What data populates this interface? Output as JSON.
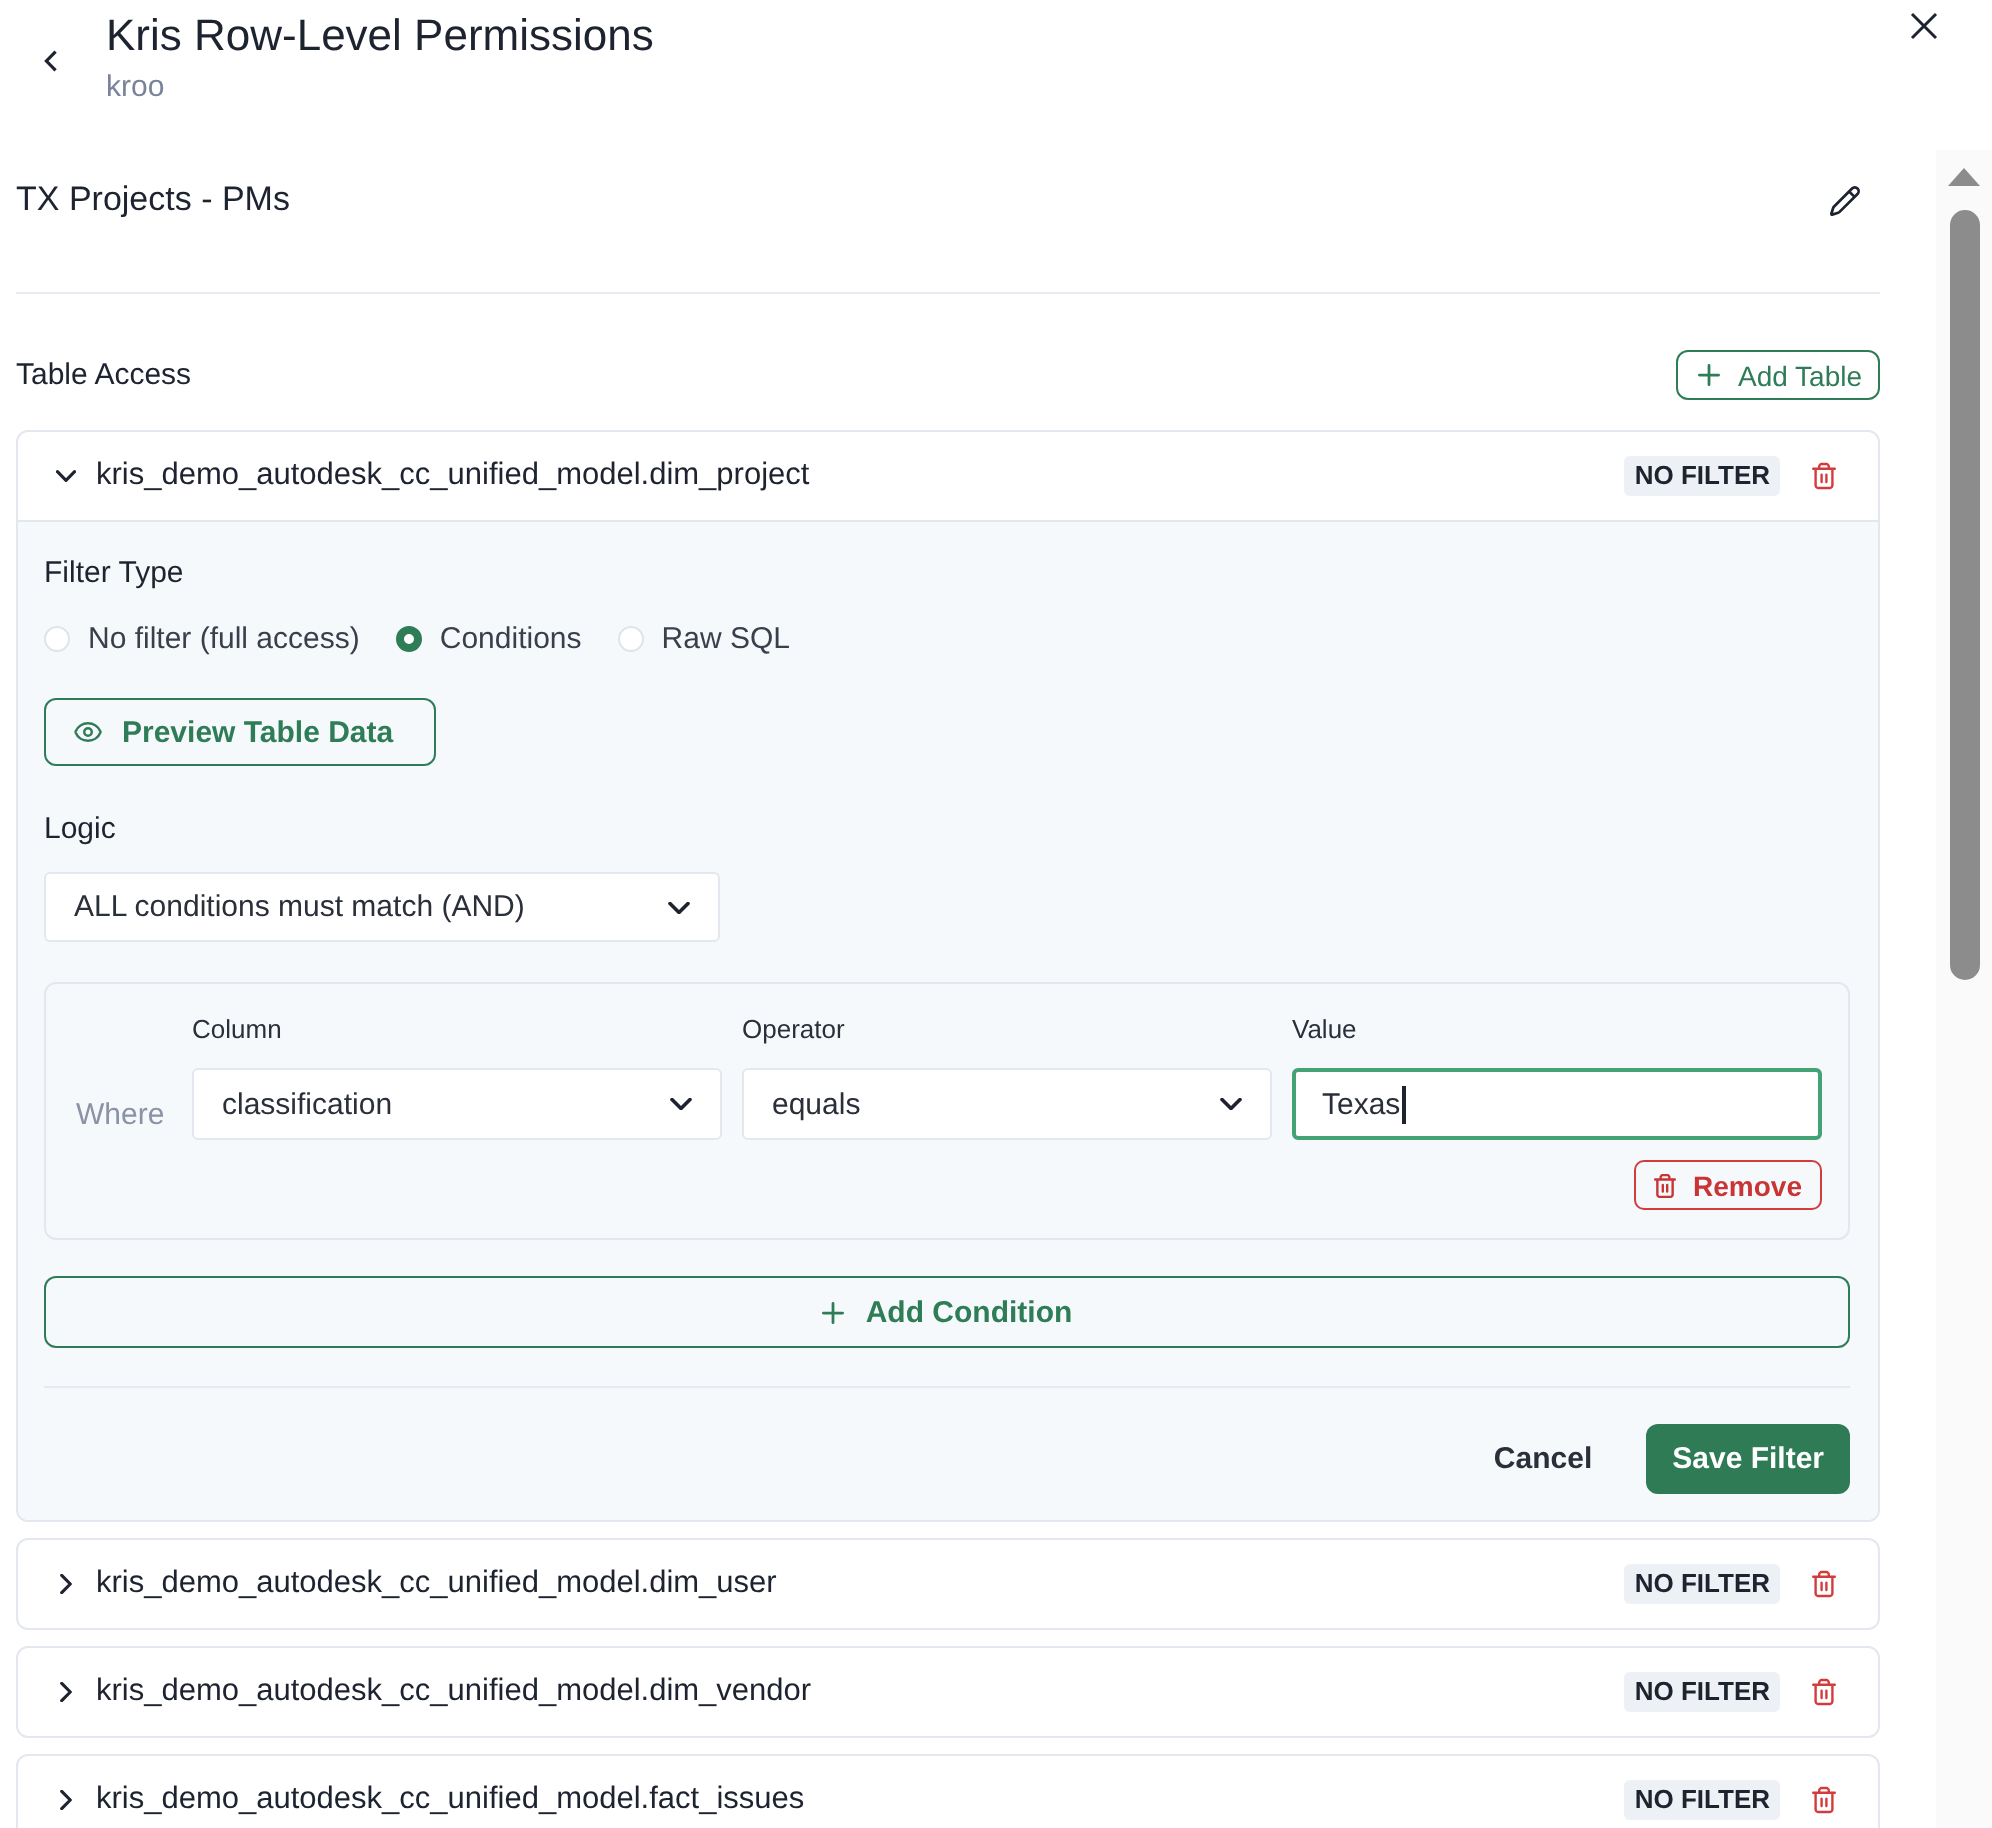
{
  "header": {
    "title": "Kris Row-Level Permissions",
    "subtitle": "kroo"
  },
  "role": {
    "name": "TX Projects - PMs"
  },
  "table_access": {
    "heading": "Table Access",
    "add_button": "Add Table",
    "tables": [
      {
        "name": "kris_demo_autodesk_cc_unified_model.dim_project",
        "badge": "NO FILTER",
        "expanded": true,
        "filter": {
          "filter_type": {
            "label": "Filter Type",
            "options": [
              {
                "label": "No filter (full access)",
                "selected": false
              },
              {
                "label": "Conditions",
                "selected": true
              },
              {
                "label": "Raw SQL",
                "selected": false
              }
            ]
          },
          "preview_button": "Preview Table Data",
          "logic": {
            "label": "Logic",
            "value": "ALL conditions must match (AND)"
          },
          "conditions": [
            {
              "prefix": "Where",
              "column": {
                "label": "Column",
                "value": "classification"
              },
              "operator": {
                "label": "Operator",
                "value": "equals"
              },
              "value": {
                "label": "Value",
                "value": "Texas",
                "focused": true
              },
              "remove_button": "Remove"
            }
          ],
          "add_condition_button": "Add Condition",
          "cancel_button": "Cancel",
          "save_button": "Save Filter"
        }
      },
      {
        "name": "kris_demo_autodesk_cc_unified_model.dim_user",
        "badge": "NO FILTER",
        "expanded": false
      },
      {
        "name": "kris_demo_autodesk_cc_unified_model.dim_vendor",
        "badge": "NO FILTER",
        "expanded": false
      },
      {
        "name": "kris_demo_autodesk_cc_unified_model.fact_issues",
        "badge": "NO FILTER",
        "expanded": false
      }
    ]
  }
}
